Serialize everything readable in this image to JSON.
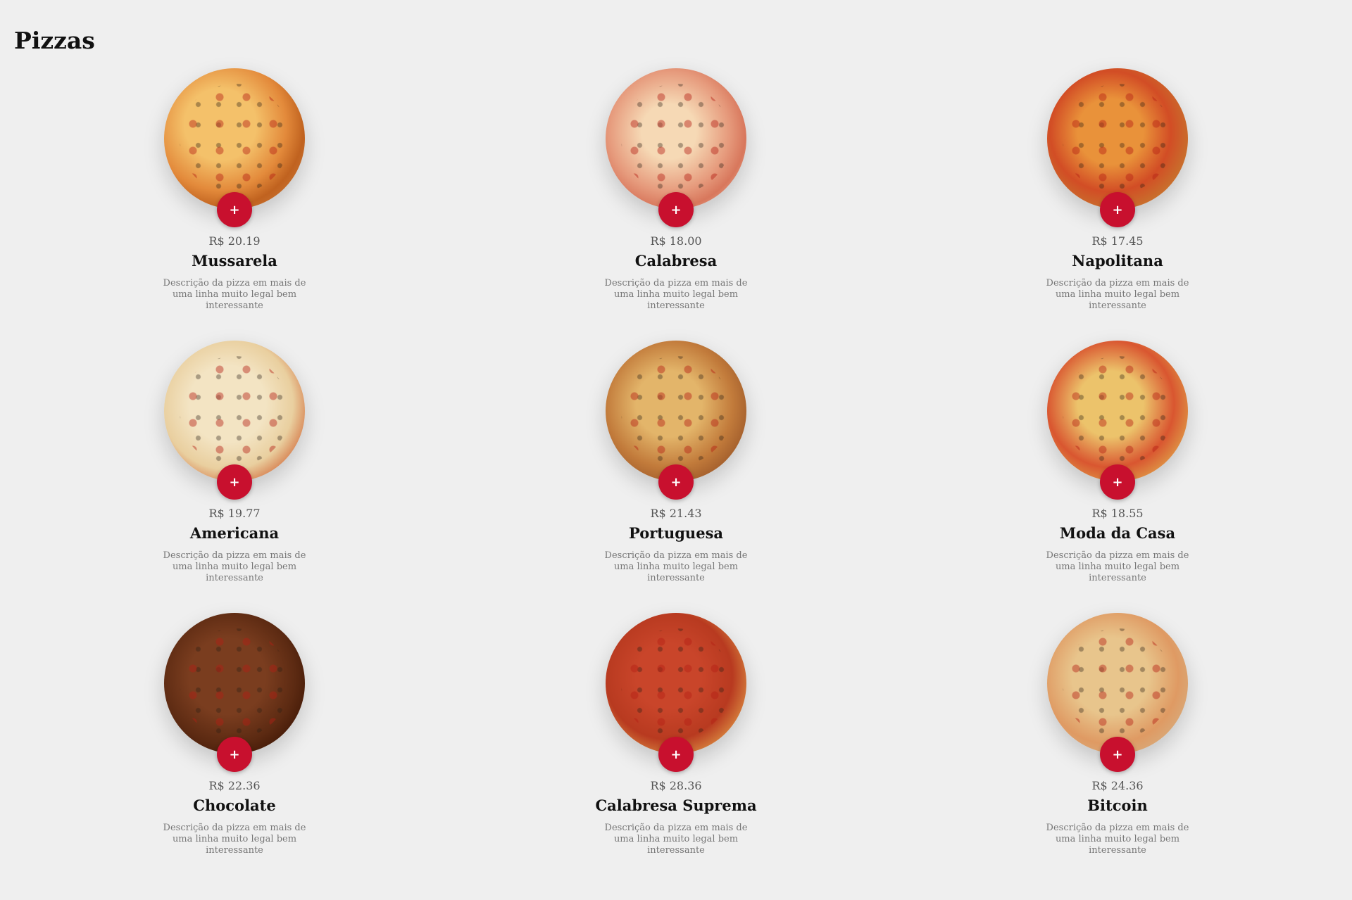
{
  "page": {
    "title": "Pizzas"
  },
  "colors": {
    "accent": "#c8102e",
    "background": "#efefef"
  },
  "items": [
    {
      "price": "R$ 20.19",
      "name": "Mussarela",
      "description": "Descrição da pizza em mais de uma linha muito legal bem interessante",
      "add_label": "+"
    },
    {
      "price": "R$ 18.00",
      "name": "Calabresa",
      "description": "Descrição da pizza em mais de uma linha muito legal bem interessante",
      "add_label": "+"
    },
    {
      "price": "R$ 17.45",
      "name": "Napolitana",
      "description": "Descrição da pizza em mais de uma linha muito legal bem interessante",
      "add_label": "+"
    },
    {
      "price": "R$ 19.77",
      "name": "Americana",
      "description": "Descrição da pizza em mais de uma linha muito legal bem interessante",
      "add_label": "+"
    },
    {
      "price": "R$ 21.43",
      "name": "Portuguesa",
      "description": "Descrição da pizza em mais de uma linha muito legal bem interessante",
      "add_label": "+"
    },
    {
      "price": "R$ 18.55",
      "name": "Moda da Casa",
      "description": "Descrição da pizza em mais de uma linha muito legal bem interessante",
      "add_label": "+"
    },
    {
      "price": "R$ 22.36",
      "name": "Chocolate",
      "description": "Descrição da pizza em mais de uma linha muito legal bem interessante",
      "add_label": "+"
    },
    {
      "price": "R$ 28.36",
      "name": "Calabresa Suprema",
      "description": "Descrição da pizza em mais de uma linha muito legal bem interessante",
      "add_label": "+"
    },
    {
      "price": "R$ 24.36",
      "name": "Bitcoin",
      "description": "Descrição da pizza em mais de uma linha muito legal bem interessante",
      "add_label": "+"
    }
  ]
}
